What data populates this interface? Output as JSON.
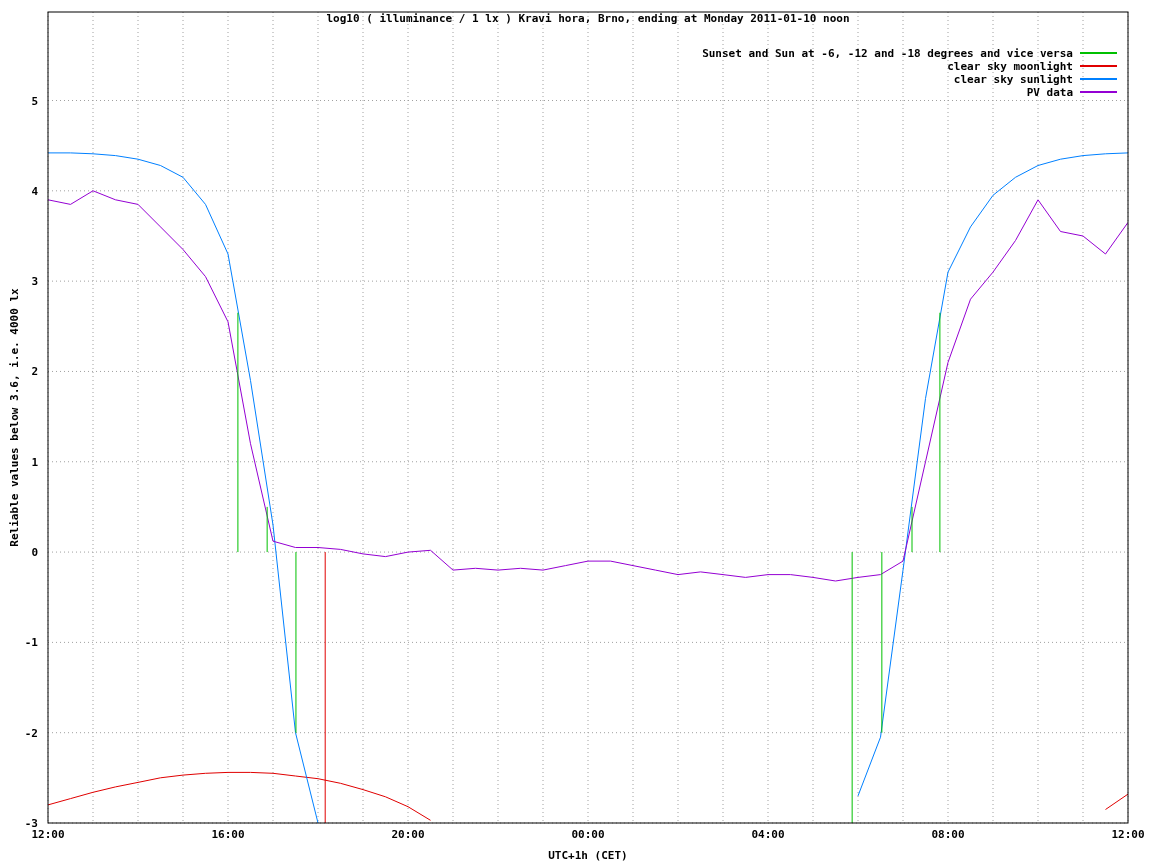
{
  "chart_data": {
    "type": "line",
    "title": "log10 ( illuminance / 1 lx ) Kravi hora, Brno, ending at Monday 2011-01-10 noon",
    "xlabel": "UTC+1h (CET)",
    "ylabel": "Reliable values below 3.6, i.e. 4000 lx",
    "categories": [
      "12:00",
      null,
      null,
      null,
      null,
      null,
      null,
      null,
      "16:00",
      null,
      null,
      null,
      null,
      null,
      null,
      null,
      "20:00",
      null,
      null,
      null,
      null,
      null,
      null,
      null,
      "00:00",
      null,
      null,
      null,
      null,
      null,
      null,
      null,
      "04:00",
      null,
      null,
      null,
      null,
      null,
      null,
      null,
      "08:00",
      null,
      null,
      null,
      null,
      null,
      null,
      null,
      "12:00"
    ],
    "ylim": [
      -3,
      5.98
    ],
    "yticks": [
      -3,
      -2,
      -1,
      0,
      1,
      2,
      3,
      4,
      5
    ],
    "series": [
      {
        "name": "Sunset and Sun at -6, -12 and -18 degrees and vice versa",
        "color": "#00c000",
        "values": [
          null,
          null,
          null,
          null,
          null,
          null,
          null,
          null,
          null,
          null,
          null,
          null,
          null,
          null,
          null,
          null,
          null,
          null,
          null,
          null,
          null,
          null,
          null,
          null,
          null,
          null,
          null,
          null,
          null,
          null,
          null,
          null,
          null,
          null,
          null,
          null,
          null,
          null,
          null,
          null,
          null,
          null,
          null,
          null,
          null,
          null,
          null,
          null,
          null
        ]
      },
      {
        "name": "clear sky moonlight",
        "color": "#e00000",
        "values": [
          -2.8,
          -2.73,
          -2.66,
          -2.6,
          -2.55,
          -2.5,
          -2.47,
          -2.45,
          -2.44,
          -2.44,
          -2.45,
          -2.48,
          -2.51,
          -2.56,
          -2.63,
          -2.71,
          -2.82,
          -2.97,
          null,
          null,
          null,
          null,
          null,
          null,
          null,
          null,
          null,
          null,
          null,
          null,
          null,
          null,
          null,
          null,
          null,
          null,
          null,
          null,
          null,
          null,
          null,
          null,
          null,
          null,
          null,
          null,
          null,
          -2.85,
          -2.68
        ]
      },
      {
        "name": "clear sky sunlight",
        "color": "#0080ff",
        "values": [
          4.42,
          4.42,
          4.41,
          4.39,
          4.35,
          4.28,
          4.15,
          3.85,
          3.3,
          1.9,
          0.3,
          -2.0,
          -3.0,
          null,
          null,
          null,
          null,
          null,
          null,
          null,
          null,
          null,
          null,
          null,
          null,
          null,
          null,
          null,
          null,
          null,
          null,
          null,
          null,
          null,
          null,
          null,
          -2.7,
          -2.05,
          -0.2,
          1.7,
          3.1,
          3.6,
          3.95,
          4.15,
          4.28,
          4.35,
          4.39,
          4.41,
          4.42
        ]
      },
      {
        "name": "PV data",
        "color": "#9400d3",
        "values": [
          3.9,
          3.85,
          4.0,
          3.9,
          3.85,
          3.6,
          3.35,
          3.05,
          2.55,
          1.2,
          0.12,
          0.05,
          0.05,
          0.03,
          -0.02,
          -0.05,
          0.0,
          0.02,
          -0.2,
          -0.18,
          -0.2,
          -0.18,
          -0.2,
          -0.15,
          -0.1,
          -0.1,
          -0.15,
          -0.2,
          -0.25,
          -0.22,
          -0.25,
          -0.28,
          -0.25,
          -0.25,
          -0.28,
          -0.32,
          -0.28,
          -0.25,
          -0.1,
          1.0,
          2.1,
          2.8,
          3.1,
          3.45,
          3.9,
          3.55,
          3.5,
          3.3,
          3.65
        ]
      }
    ],
    "grid": true,
    "legend": true
  }
}
